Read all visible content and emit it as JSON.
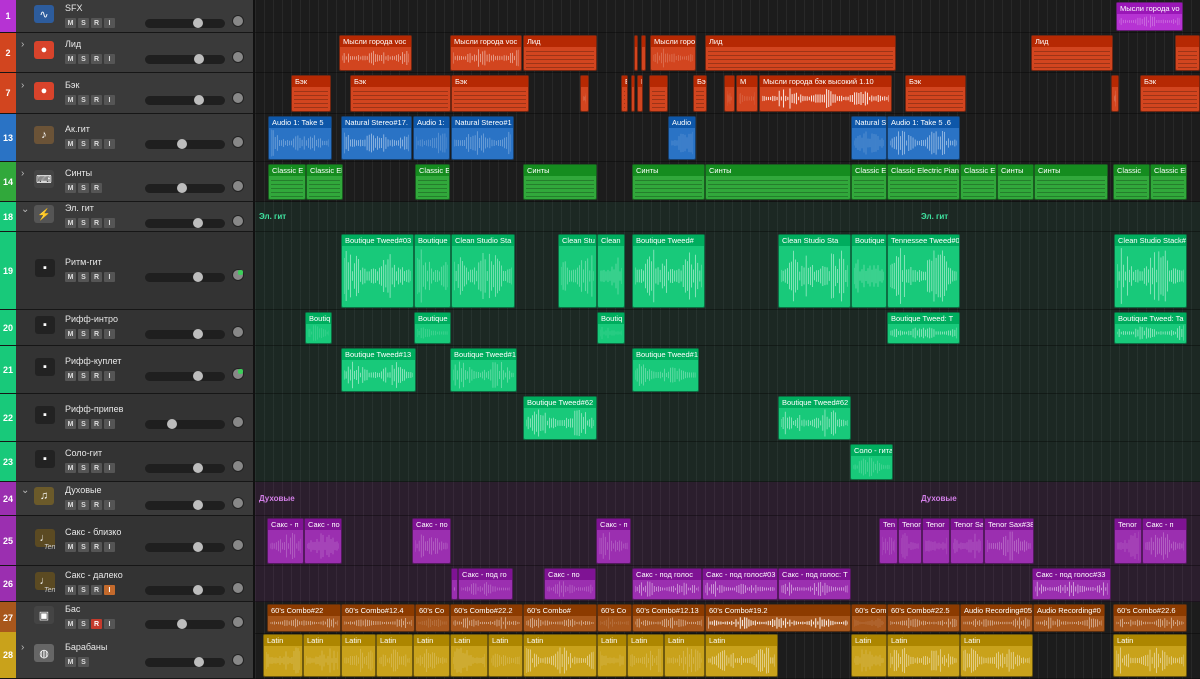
{
  "ui": {
    "mute_label": "M",
    "solo_label": "S",
    "record_label": "R",
    "input_label": "I"
  },
  "tracks": [
    {
      "num": "1",
      "name": "SFX",
      "color": "#b633d3",
      "icon": "waveform-icon",
      "buttons": [
        "M",
        "S",
        "R",
        "I"
      ],
      "fader": 0.68,
      "group": null
    },
    {
      "num": "2",
      "name": "Лид",
      "color": "#d2451f",
      "icon": "singer-icon",
      "buttons": [
        "M",
        "S",
        "R",
        "I"
      ],
      "fader": 0.7,
      "group": "chevron"
    },
    {
      "num": "7",
      "name": "Бэк",
      "color": "#d2451f",
      "icon": "singer-icon",
      "buttons": [
        "M",
        "S",
        "R",
        "I"
      ],
      "fader": 0.7,
      "group": "chevron"
    },
    {
      "num": "13",
      "name": "Ак.гит",
      "color": "#2a73c5",
      "icon": "acoustic-guitar-icon",
      "buttons": [
        "M",
        "S",
        "R",
        "I"
      ],
      "fader": 0.46,
      "group": null
    },
    {
      "num": "14",
      "name": "Синты",
      "color": "#31a83b",
      "icon": "keyboard-icon",
      "buttons": [
        "M",
        "S",
        "R"
      ],
      "fader": 0.46,
      "group": "chevron"
    },
    {
      "num": "18",
      "name": "Эл. гит",
      "color": "#18c97a",
      "icon": "electric-guitar-icon",
      "buttons": [
        "M",
        "S",
        "R",
        "I"
      ],
      "fader": 0.68,
      "group": "chevron-open"
    },
    {
      "num": "19",
      "name": "Ритм-гит",
      "color": "#18c97a",
      "icon": "amp-icon",
      "buttons": [
        "M",
        "S",
        "R",
        "I"
      ],
      "fader": 0.68,
      "group": "sub"
    },
    {
      "num": "20",
      "name": "Рифф-интро",
      "color": "#18c97a",
      "icon": "amp-icon",
      "buttons": [
        "M",
        "S",
        "R",
        "I"
      ],
      "fader": 0.68,
      "group": "sub"
    },
    {
      "num": "21",
      "name": "Рифф-куплет",
      "color": "#18c97a",
      "icon": "amp-icon",
      "buttons": [
        "M",
        "S",
        "R",
        "I"
      ],
      "fader": 0.68,
      "group": "sub"
    },
    {
      "num": "22",
      "name": "Рифф-припев",
      "color": "#18c97a",
      "icon": "amp-icon",
      "buttons": [
        "M",
        "S",
        "R",
        "I"
      ],
      "fader": 0.32,
      "group": "sub"
    },
    {
      "num": "23",
      "name": "Соло-гит",
      "color": "#18c97a",
      "icon": "amp-icon",
      "buttons": [
        "M",
        "S",
        "R",
        "I"
      ],
      "fader": 0.68,
      "group": "sub"
    },
    {
      "num": "24",
      "name": "Духовые",
      "color": "#9b2fb0",
      "icon": "trumpet-icon",
      "buttons": [
        "M",
        "S",
        "R",
        "I"
      ],
      "fader": 0.68,
      "group": "chevron-open"
    },
    {
      "num": "25",
      "name": "Сакс - близко",
      "color": "#9b2fb0",
      "icon": "sax-icon",
      "icon_label": "Ten",
      "buttons": [
        "M",
        "S",
        "R",
        "I"
      ],
      "fader": 0.68,
      "group": "sub"
    },
    {
      "num": "26",
      "name": "Сакс  - далеко",
      "color": "#9b2fb0",
      "icon": "sax-icon",
      "icon_label": "Ten",
      "buttons": [
        "M",
        "S",
        "R",
        "I"
      ],
      "fader": 0.68,
      "group": "sub",
      "input_on": true
    },
    {
      "num": "27",
      "name": "Бас",
      "color": "#a8571c",
      "icon": "bass-amp-icon",
      "buttons": [
        "M",
        "S",
        "R",
        "I"
      ],
      "fader": 0.46,
      "group": null,
      "record_on": true
    },
    {
      "num": "28",
      "name": "Барабаны",
      "color": "#c9a21b",
      "icon": "drums-icon",
      "buttons": [
        "M",
        "S"
      ],
      "fader": 0.7,
      "group": "chevron"
    }
  ],
  "folder_labels": {
    "el_guitar": [
      "Эл. гит",
      "Эл. гит"
    ],
    "winds": [
      "Духовые",
      "Духовые"
    ]
  },
  "lanes": [
    {
      "regions": [
        {
          "label": "Мысли города vo",
          "kind": "audio"
        }
      ]
    },
    {
      "regions": [
        {
          "label": "Мысли города voc",
          "kind": "audio"
        },
        {
          "label": "Мысли города voc",
          "kind": "audio"
        },
        {
          "label": "Лид",
          "kind": "midi"
        },
        {
          "label": "",
          "kind": "audio"
        },
        {
          "label": "",
          "kind": "audio"
        },
        {
          "label": "Мысли горо",
          "kind": "audio"
        },
        {
          "label": "Лид",
          "kind": "midi"
        },
        {
          "label": "Лид",
          "kind": "midi"
        },
        {
          "label": "",
          "kind": "midi"
        }
      ]
    },
    {
      "regions": [
        {
          "label": "Бэк",
          "kind": "midi"
        },
        {
          "label": "Бэк",
          "kind": "midi"
        },
        {
          "label": "Бэк",
          "kind": "midi"
        },
        {
          "label": "",
          "kind": "audio"
        },
        {
          "label": "Ба",
          "kind": "midi"
        },
        {
          "label": "",
          "kind": "midi"
        },
        {
          "label": "Б",
          "kind": "midi"
        },
        {
          "label": "",
          "kind": "midi"
        },
        {
          "label": "Бэк",
          "kind": "midi"
        },
        {
          "label": "",
          "kind": "audio"
        },
        {
          "label": "М",
          "kind": "audio"
        },
        {
          "label": "Мысли города бэк высокий 1.10",
          "kind": "audio"
        },
        {
          "label": "Бэк",
          "kind": "midi"
        },
        {
          "label": "",
          "kind": "audio"
        },
        {
          "label": "Бэк",
          "kind": "midi"
        }
      ]
    },
    {
      "regions": [
        {
          "label": "Audio 1: Take 5",
          "kind": "audio"
        },
        {
          "label": "Natural Stereo#17.",
          "kind": "audio"
        },
        {
          "label": "Audio 1:",
          "kind": "audio"
        },
        {
          "label": "Natural Stereo#1",
          "kind": "audio"
        },
        {
          "label": "Audio",
          "kind": "audio"
        },
        {
          "label": "Natural S",
          "kind": "audio"
        },
        {
          "label": "Audio 1: Take 5 .6",
          "kind": "audio"
        }
      ]
    },
    {
      "regions": [
        {
          "label": "Classic E",
          "kind": "midi"
        },
        {
          "label": "Classic El",
          "kind": "midi"
        },
        {
          "label": "Classic E",
          "kind": "midi"
        },
        {
          "label": "Синты",
          "kind": "midi"
        },
        {
          "label": "Синты",
          "kind": "midi"
        },
        {
          "label": "Синты",
          "kind": "midi"
        },
        {
          "label": "Classic El",
          "kind": "midi"
        },
        {
          "label": "Classic Electric Pian",
          "kind": "midi"
        },
        {
          "label": "Classic E",
          "kind": "midi"
        },
        {
          "label": "Синты",
          "kind": "midi"
        },
        {
          "label": "Синты",
          "kind": "midi"
        },
        {
          "label": "Classic",
          "kind": "midi"
        },
        {
          "label": "Classic Electric Pian",
          "kind": "midi"
        }
      ]
    },
    {
      "regions": []
    },
    {
      "regions": [
        {
          "label": "Boutique Tweed#03",
          "kind": "audio"
        },
        {
          "label": "Boutique",
          "kind": "audio"
        },
        {
          "label": "Clean Studio Sta",
          "kind": "audio"
        },
        {
          "label": "Clean Stu",
          "kind": "audio"
        },
        {
          "label": "Clean",
          "kind": "audio"
        },
        {
          "label": "Boutique Tweed#",
          "kind": "audio"
        },
        {
          "label": "Clean Studio Sta",
          "kind": "audio"
        },
        {
          "label": "Boutique",
          "kind": "audio"
        },
        {
          "label": "Tennessee Tweed#0",
          "kind": "audio"
        },
        {
          "label": "Clean Studio Stack#",
          "kind": "audio"
        }
      ]
    },
    {
      "regions": [
        {
          "label": "Boutiq",
          "kind": "audio"
        },
        {
          "label": "Boutique",
          "kind": "audio"
        },
        {
          "label": "Boutiq",
          "kind": "audio"
        },
        {
          "label": "Boutique Tweed: T",
          "kind": "audio"
        },
        {
          "label": "Boutique Tweed: Ta",
          "kind": "audio"
        }
      ]
    },
    {
      "regions": [
        {
          "label": "Boutique Tweed#13",
          "kind": "audio"
        },
        {
          "label": "Boutique Tweed#1",
          "kind": "audio"
        },
        {
          "label": "Boutique Tweed#1",
          "kind": "audio"
        }
      ]
    },
    {
      "regions": [
        {
          "label": "Boutique Tweed#62",
          "kind": "audio"
        },
        {
          "label": "Boutique Tweed#62",
          "kind": "audio"
        }
      ]
    },
    {
      "regions": [
        {
          "label": "Соло - гита",
          "kind": "audio"
        }
      ]
    },
    {
      "regions": []
    },
    {
      "regions": [
        {
          "label": "Сакс - п",
          "kind": "audio"
        },
        {
          "label": "Сакс - по",
          "kind": "audio"
        },
        {
          "label": "Сакс - по",
          "kind": "audio"
        },
        {
          "label": "Сакс - п",
          "kind": "audio"
        },
        {
          "label": "Ten",
          "kind": "audio"
        },
        {
          "label": "Tenor",
          "kind": "audio"
        },
        {
          "label": "Tenor",
          "kind": "audio"
        },
        {
          "label": "Tenor Sa",
          "kind": "audio"
        },
        {
          "label": "Tenor Sax#38",
          "kind": "audio"
        },
        {
          "label": "Tenor",
          "kind": "audio"
        },
        {
          "label": "Сакс - п",
          "kind": "audio"
        }
      ]
    },
    {
      "regions": [
        {
          "label": "",
          "kind": "audio"
        },
        {
          "label": "Сакс - под го",
          "kind": "audio"
        },
        {
          "label": "Сакс - по",
          "kind": "audio"
        },
        {
          "label": "Сакс - под голос",
          "kind": "audio"
        },
        {
          "label": "Сакс - под голос#03",
          "kind": "audio"
        },
        {
          "label": "Сакс - под голос: Т",
          "kind": "audio"
        },
        {
          "label": "Сакс - под голос#33",
          "kind": "audio"
        }
      ]
    },
    {
      "regions": [
        {
          "label": "60's Combo#22",
          "kind": "audio"
        },
        {
          "label": "60's Combo#12.4",
          "kind": "audio"
        },
        {
          "label": "60's Co",
          "kind": "audio"
        },
        {
          "label": "60's Combo#22.2",
          "kind": "audio"
        },
        {
          "label": "60's Combo#",
          "kind": "audio"
        },
        {
          "label": "60's Co",
          "kind": "audio"
        },
        {
          "label": "60's Combo#12.13",
          "kind": "audio"
        },
        {
          "label": "60's Combo#19.2",
          "kind": "audio"
        },
        {
          "label": "60's Com",
          "kind": "audio"
        },
        {
          "label": "60's Combo#22.5",
          "kind": "audio"
        },
        {
          "label": "Audio Recording#05",
          "kind": "audio"
        },
        {
          "label": "Audio Recording#0",
          "kind": "audio"
        },
        {
          "label": "60's Combo#22.6",
          "kind": "audio"
        }
      ]
    },
    {
      "regions": [
        {
          "label": "Latin",
          "kind": "audio"
        },
        {
          "label": "Latin",
          "kind": "audio"
        },
        {
          "label": "Latin",
          "kind": "audio"
        },
        {
          "label": "Latin",
          "kind": "audio"
        },
        {
          "label": "Latin",
          "kind": "audio"
        },
        {
          "label": "Latin",
          "kind": "audio"
        },
        {
          "label": "Latin",
          "kind": "audio"
        },
        {
          "label": "Latin",
          "kind": "audio"
        },
        {
          "label": "Latin",
          "kind": "audio"
        },
        {
          "label": "Latin",
          "kind": "audio"
        },
        {
          "label": "Latin",
          "kind": "audio"
        },
        {
          "label": "Latin",
          "kind": "audio"
        },
        {
          "label": "Latin",
          "kind": "audio"
        },
        {
          "label": "Latin",
          "kind": "audio"
        },
        {
          "label": "Latin",
          "kind": "audio"
        },
        {
          "label": "Latin",
          "kind": "audio"
        }
      ]
    }
  ]
}
